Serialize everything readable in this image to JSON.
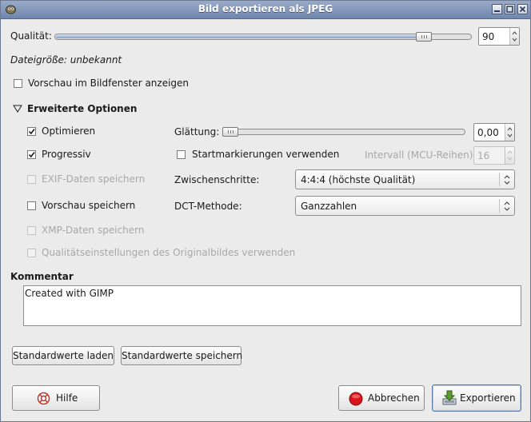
{
  "window": {
    "title": "Bild exportieren als JPEG"
  },
  "quality": {
    "label": "Qualität:",
    "value": "90",
    "slider_fraction": 0.9
  },
  "filesize": {
    "text": "Dateigröße: unbekannt"
  },
  "preview_window": {
    "label": "Vorschau im Bildfenster anzeigen",
    "checked": false
  },
  "advanced": {
    "label": "Erweiterte Optionen",
    "optimize": {
      "label": "Optimieren",
      "checked": true
    },
    "progressive": {
      "label": "Progressiv",
      "checked": true
    },
    "exif": {
      "label": "EXIF-Daten speichern",
      "checked": false,
      "enabled": false
    },
    "thumbnail": {
      "label": "Vorschau speichern",
      "checked": false
    },
    "xmp": {
      "label": "XMP-Daten speichern",
      "checked": false,
      "enabled": false
    },
    "orig_quality": {
      "label": "Qualitätseinstellungen des Originalbildes verwenden",
      "checked": false,
      "enabled": false
    },
    "smoothing": {
      "label": "Glättung:",
      "value": "0,00",
      "slider_fraction": 0.0
    },
    "restart_markers": {
      "label": "Startmarkierungen verwenden",
      "checked": false
    },
    "interval": {
      "label": "Intervall (MCU-Reihen):",
      "value": "16",
      "enabled": false
    },
    "subsampling": {
      "label": "Zwischenschritte:",
      "value": "4:4:4 (höchste Qualität)"
    },
    "dct": {
      "label": "DCT-Methode:",
      "value": "Ganzzahlen"
    }
  },
  "comment": {
    "label": "Kommentar",
    "value": "Created with GIMP"
  },
  "buttons": {
    "load_defaults": "Standardwerte laden",
    "save_defaults": "Standardwerte speichern",
    "help": "Hilfe",
    "cancel": "Abbrechen",
    "export": "Exportieren"
  },
  "colors": {
    "titlebar": "#7d92b6",
    "slider_fill": "#7fa0cd",
    "cancel_red": "#d8141a",
    "export_green": "#5b9a2f"
  }
}
